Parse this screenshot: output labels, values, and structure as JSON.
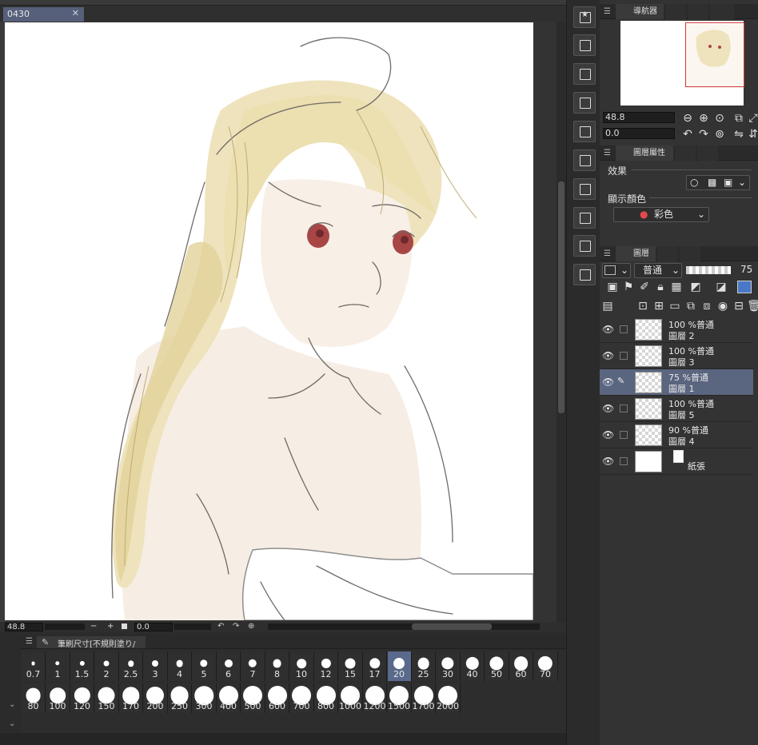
{
  "document": {
    "tab_title": "0430",
    "close_glyph": "✕"
  },
  "canvas": {
    "zoom": "48.8",
    "rotation": "0.0",
    "nav_minus": "−",
    "nav_plus": "+"
  },
  "brush_palette": {
    "tab_label": "筆刷尺寸[不規則塗り/潤]",
    "sizes_row1": [
      "0.7",
      "1",
      "1.5",
      "2",
      "2.5",
      "3",
      "4",
      "5",
      "6",
      "7",
      "8",
      "10",
      "12",
      "15",
      "17",
      "20",
      "25",
      "30",
      "40",
      "50",
      "60",
      "70"
    ],
    "sizes_row2": [
      "80",
      "100",
      "120",
      "150",
      "170",
      "200",
      "250",
      "300",
      "400",
      "500",
      "600",
      "700",
      "800",
      "1000",
      "1200",
      "1500",
      "1700",
      "2000"
    ],
    "selected": "20"
  },
  "navigator": {
    "tab_label": "導航器",
    "zoom_value": "48.8",
    "rotation_value": "0.0"
  },
  "layer_property": {
    "tab_label": "圖層屬性",
    "effect_label": "效果",
    "display_color_label": "顯示顏色",
    "display_color_value": "彩色"
  },
  "layers_panel": {
    "tab_label": "圖層",
    "blend_mode": "普通",
    "opacity": "75",
    "layers": [
      {
        "opacity_mode": "100 %普通",
        "name": "圖層 2",
        "active": false
      },
      {
        "opacity_mode": "100 %普通",
        "name": "圖層 3",
        "active": false
      },
      {
        "opacity_mode": "75 %普通",
        "name": "圖層 1",
        "active": true
      },
      {
        "opacity_mode": "100 %普通",
        "name": "圖層 5",
        "active": false
      },
      {
        "opacity_mode": "90 %普通",
        "name": "圖層 4",
        "active": false
      },
      {
        "opacity_mode": "",
        "name": "紙張",
        "active": false
      }
    ]
  },
  "colors": {
    "accent_selected": "#5a6a8c",
    "active_layer": "#5a6580",
    "navigator_frame": "#d23a3a",
    "tab_active": "#56607a"
  },
  "icons": [
    "star-icon",
    "save-icon",
    "grid-icon",
    "folder-icon",
    "edit-icon",
    "export-icon",
    "walk-icon",
    "eye-icon",
    "pen-icon",
    "hamburger-icon"
  ]
}
